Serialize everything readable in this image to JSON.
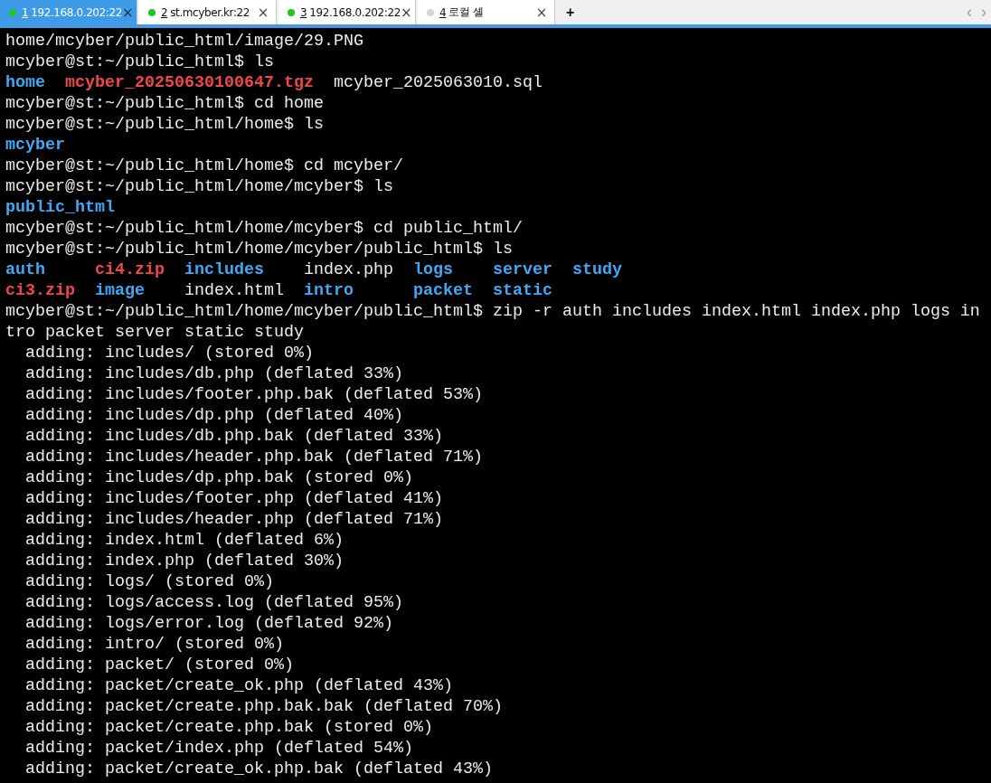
{
  "tabs": [
    {
      "number": "1",
      "label": "192.168.0.202:22",
      "selected": true,
      "color": "#1ec81e"
    },
    {
      "number": "2",
      "label": "st.mcyber.kr:22",
      "selected": false,
      "color": "#1ec81e"
    },
    {
      "number": "3",
      "label": "192.168.0.202:22",
      "selected": false,
      "color": "#1ec81e"
    },
    {
      "number": "4",
      "label": "로컬 셸",
      "selected": false,
      "color": "#d4d4d4"
    }
  ],
  "tab_close": "×",
  "new_tab": "+",
  "scroll_left": "‹",
  "scroll_right": "›",
  "terminal": [
    {
      "kind": "text",
      "text": "home/mcyber/public_html/image/29.PNG"
    },
    {
      "kind": "text",
      "text": "mcyber@st:~/public_html$ ls"
    },
    {
      "kind": "ls",
      "rows": [
        [
          {
            "name": "home",
            "kind": "dir"
          },
          {
            "name": "mcyber_20250630100647.tgz",
            "kind": "archive"
          },
          {
            "name": "mcyber_2025063010.sql",
            "kind": "file"
          }
        ]
      ]
    },
    {
      "kind": "text",
      "text": "mcyber@st:~/public_html$ cd home"
    },
    {
      "kind": "text",
      "text": "mcyber@st:~/public_html/home$ ls"
    },
    {
      "kind": "ls",
      "rows": [
        [
          {
            "name": "mcyber",
            "kind": "dir"
          }
        ]
      ]
    },
    {
      "kind": "text",
      "text": "mcyber@st:~/public_html/home$ cd mcyber/"
    },
    {
      "kind": "text",
      "text": "mcyber@st:~/public_html/home/mcyber$ ls"
    },
    {
      "kind": "ls",
      "rows": [
        [
          {
            "name": "public_html",
            "kind": "dir"
          }
        ]
      ]
    },
    {
      "kind": "text",
      "text": "mcyber@st:~/public_html/home/mcyber$ cd public_html/"
    },
    {
      "kind": "text",
      "text": "mcyber@st:~/public_html/home/mcyber/public_html$ ls"
    },
    {
      "kind": "ls",
      "rows": [
        [
          {
            "name": "auth",
            "kind": "dir"
          },
          {
            "name": "ci4.zip",
            "kind": "archive"
          },
          {
            "name": "includes",
            "kind": "dir"
          },
          {
            "name": "index.php",
            "kind": "file"
          },
          {
            "name": "logs",
            "kind": "dir"
          },
          {
            "name": "server",
            "kind": "dir"
          },
          {
            "name": "study",
            "kind": "dir"
          }
        ],
        [
          {
            "name": "ci3.zip",
            "kind": "archive"
          },
          {
            "name": "image",
            "kind": "dir"
          },
          {
            "name": "index.html",
            "kind": "file"
          },
          {
            "name": "intro",
            "kind": "dir"
          },
          {
            "name": "packet",
            "kind": "dir"
          },
          {
            "name": "static",
            "kind": "dir"
          }
        ]
      ]
    },
    {
      "kind": "text",
      "text": "mcyber@st:~/public_html/home/mcyber/public_html$ zip -r auth includes index.html index.php logs in"
    },
    {
      "kind": "text",
      "text": "tro packet server static study"
    },
    {
      "kind": "text",
      "text": "  adding: includes/ (stored 0%)"
    },
    {
      "kind": "text",
      "text": "  adding: includes/db.php (deflated 33%)"
    },
    {
      "kind": "text",
      "text": "  adding: includes/footer.php.bak (deflated 53%)"
    },
    {
      "kind": "text",
      "text": "  adding: includes/dp.php (deflated 40%)"
    },
    {
      "kind": "text",
      "text": "  adding: includes/db.php.bak (deflated 33%)"
    },
    {
      "kind": "text",
      "text": "  adding: includes/header.php.bak (deflated 71%)"
    },
    {
      "kind": "text",
      "text": "  adding: includes/dp.php.bak (stored 0%)"
    },
    {
      "kind": "text",
      "text": "  adding: includes/footer.php (deflated 41%)"
    },
    {
      "kind": "text",
      "text": "  adding: includes/header.php (deflated 71%)"
    },
    {
      "kind": "text",
      "text": "  adding: index.html (deflated 6%)"
    },
    {
      "kind": "text",
      "text": "  adding: index.php (deflated 30%)"
    },
    {
      "kind": "text",
      "text": "  adding: logs/ (stored 0%)"
    },
    {
      "kind": "text",
      "text": "  adding: logs/access.log (deflated 95%)"
    },
    {
      "kind": "text",
      "text": "  adding: logs/error.log (deflated 92%)"
    },
    {
      "kind": "text",
      "text": "  adding: intro/ (stored 0%)"
    },
    {
      "kind": "text",
      "text": "  adding: packet/ (stored 0%)"
    },
    {
      "kind": "text",
      "text": "  adding: packet/create_ok.php (deflated 43%)"
    },
    {
      "kind": "text",
      "text": "  adding: packet/create.php.bak.bak (deflated 70%)"
    },
    {
      "kind": "text",
      "text": "  adding: packet/create.php.bak (stored 0%)"
    },
    {
      "kind": "text",
      "text": "  adding: packet/index.php (deflated 54%)"
    },
    {
      "kind": "text",
      "text": "  adding: packet/create_ok.php.bak (deflated 43%)"
    }
  ]
}
